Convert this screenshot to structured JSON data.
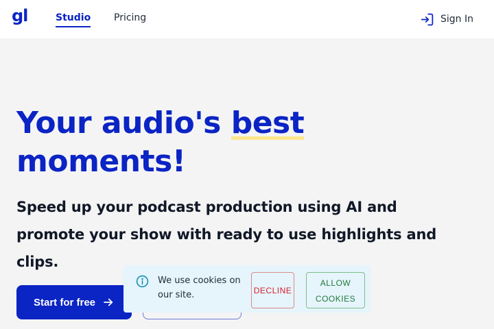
{
  "header": {
    "logo": "gl",
    "nav": [
      {
        "label": "Studio",
        "active": true
      },
      {
        "label": "Pricing",
        "active": false
      }
    ],
    "signin_label": "Sign In",
    "signin_icon": "sign-in-icon"
  },
  "hero": {
    "title_part1": "Your audio's ",
    "title_highlight": "best",
    "title_part2": "moments!",
    "subtitle": "Speed up your podcast production using AI and promote your show with ready to use highlights and clips.",
    "cta_primary": "Start for free",
    "cta_primary_icon": "arrow-right-icon"
  },
  "cookie_banner": {
    "icon": "info-icon",
    "message": "We use cookies on our site.",
    "decline_label": "DECLINE",
    "allow_line1": "ALLOW",
    "allow_line2": "COOKIES"
  },
  "colors": {
    "brand": "#0b24c4",
    "highlight": "#fde68a",
    "cookie_bg": "#e6f4fb",
    "decline": "#d61f2b",
    "allow": "#1f7a3a"
  }
}
